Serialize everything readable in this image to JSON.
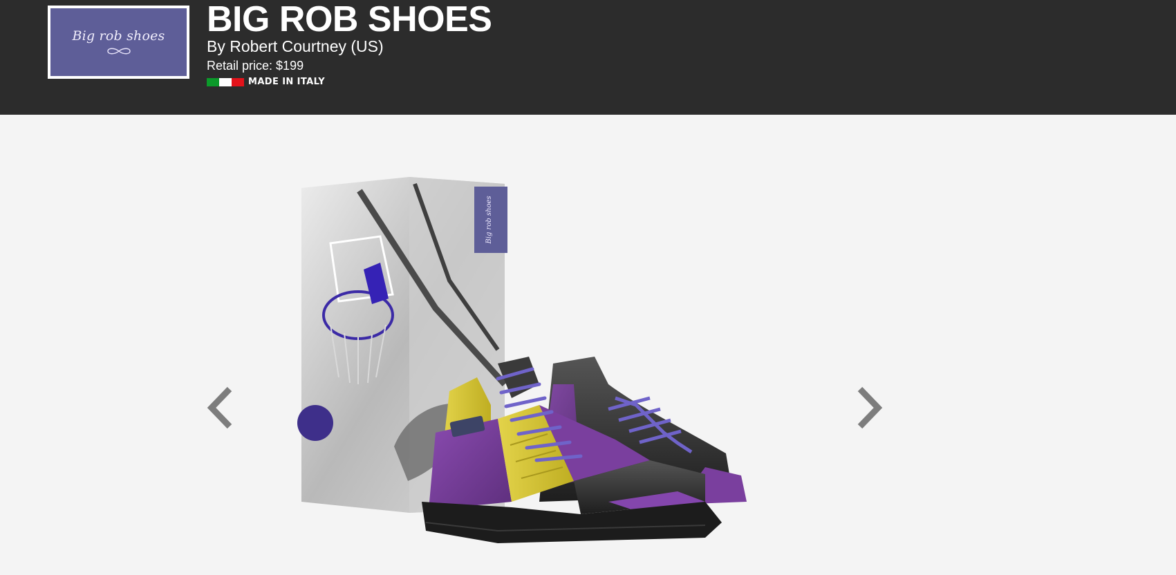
{
  "header": {
    "logo_text": "Big rob shoes",
    "title": "BIG ROB SHOES",
    "byline": "By Robert Courtney (US)",
    "price_label": "Retail price:",
    "price_value": "$199",
    "origin_text": "MADE IN ITALY",
    "flag_colors": [
      "#0b9a2a",
      "#ffffff",
      "#e3131b"
    ]
  },
  "gallery": {
    "prev_icon": "chevron-left-icon",
    "next_icon": "chevron-right-icon",
    "box_label": "Big rob shoes",
    "image_subject": "purple-yellow-black high-top sneakers with box",
    "colors": {
      "accent_purple": "#5e5e98",
      "shoe_purple": "#7a3f9e",
      "shoe_yellow": "#d9c935",
      "shoe_black": "#2b2b2b",
      "laces": "#6f63c9"
    }
  }
}
